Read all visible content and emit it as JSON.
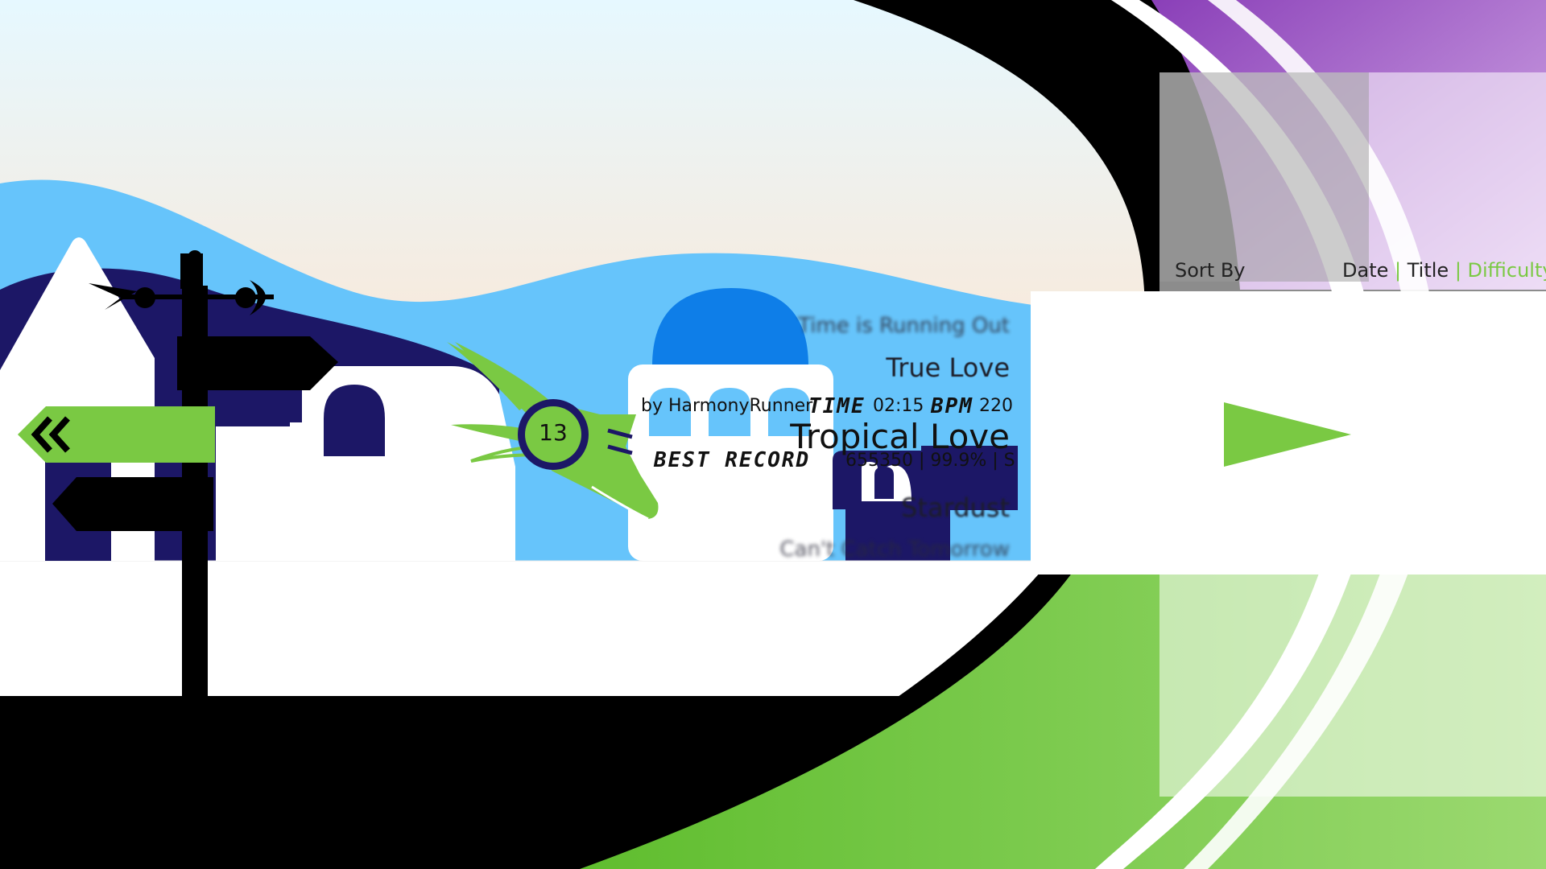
{
  "song_list": {
    "items": [
      {
        "title": "Time is Running Out"
      },
      {
        "title": "True Love"
      },
      {
        "title": "Tropical Love"
      },
      {
        "title": "Stardust"
      },
      {
        "title": "Can't Catch Tomorrow"
      }
    ],
    "selected_index": 2
  },
  "selected_song": {
    "title": "Tropical Love",
    "artist": "by HarmonyRunner",
    "level": "13",
    "time_label": "TIME",
    "time_value": "02:15",
    "bpm_label": "BPM",
    "bpm_value": "220",
    "best_record_label": "BEST RECORD",
    "best_record_value": "655350 | 99.9% | S"
  },
  "sort": {
    "label": "Sort By",
    "options": [
      "Date",
      "Title",
      "Difficulty"
    ],
    "separator": "|",
    "active": "Difficulty"
  },
  "icons": {
    "back": "double-chevron-left-icon",
    "play": "play-triangle-icon",
    "level_badge": "winged-shoe-badge-icon",
    "weathervane": "weathervane-icon"
  },
  "colors": {
    "accent_green": "#7ac943",
    "accent_purple": "#9b59c5",
    "navy": "#1c1766",
    "sky_blue": "#66c4fb",
    "dome_blue": "#0e7ee8",
    "sky_top": "#e8f8ff",
    "sky_bottom": "#f5c27e"
  }
}
